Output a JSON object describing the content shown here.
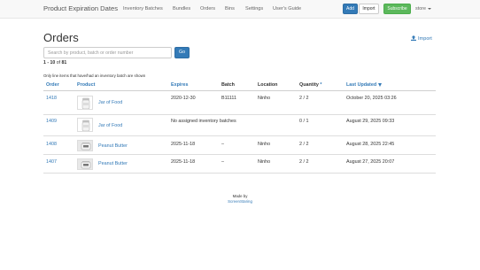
{
  "navbar": {
    "brand": "Product Expiration Dates",
    "links": [
      "Inventory Batches",
      "Bundles",
      "Orders",
      "Bins",
      "Settings",
      "User's Guide"
    ],
    "add_label": "Add",
    "import_label": "Import",
    "subscribe_label": "Subscribe",
    "store_label": "store"
  },
  "header": {
    "title": "Orders",
    "import_label": "Import"
  },
  "search": {
    "placeholder": "Search by product, batch or order number",
    "value": "",
    "go_label": "Go"
  },
  "pagination": {
    "range": "1 - 10",
    "of_word": "of",
    "total": "81"
  },
  "note": "Only line items that have/had an inventory batch are shown",
  "table": {
    "columns": [
      "Order",
      "Product",
      "Expires",
      "Batch",
      "Location",
      "Quantity",
      "Last Updated"
    ],
    "quantity_marker": "*",
    "rows": [
      {
        "order": "1418",
        "product": "Jar of Food",
        "image": "jar",
        "expires": "2020-12-30",
        "batch": "B11111",
        "location": "Ninho",
        "quantity": "2 / 2",
        "updated": "October 20, 2025 03:26"
      },
      {
        "order": "1409",
        "product": "Jar of Food",
        "image": "jar",
        "expires": "No assigned inventory batches",
        "batch": "",
        "location": "",
        "quantity": "0 / 1",
        "updated": "August 29, 2025 09:33"
      },
      {
        "order": "1408",
        "product": "Peanut Butter",
        "image": "peanut-butter",
        "expires": "2025-11-18",
        "batch": "–",
        "location": "Ninho",
        "quantity": "2 / 2",
        "updated": "August 28, 2025 22:45"
      },
      {
        "order": "1407",
        "product": "Peanut Butter",
        "image": "peanut-butter",
        "expires": "2025-11-18",
        "batch": "–",
        "location": "Ninho",
        "quantity": "2 / 2",
        "updated": "August 27, 2025 20:07"
      }
    ]
  },
  "footer": {
    "made_by": "Made by",
    "company": "ScreenStaring"
  },
  "colors": {
    "link": "#337ab7",
    "primary_button": "#337ab7",
    "success_button": "#5cb85c",
    "navbar_bg": "#f8f8f8"
  },
  "icons": {
    "import": "upload-icon",
    "sort": "sort-down-icon",
    "menu": "chevron-down-icon"
  }
}
